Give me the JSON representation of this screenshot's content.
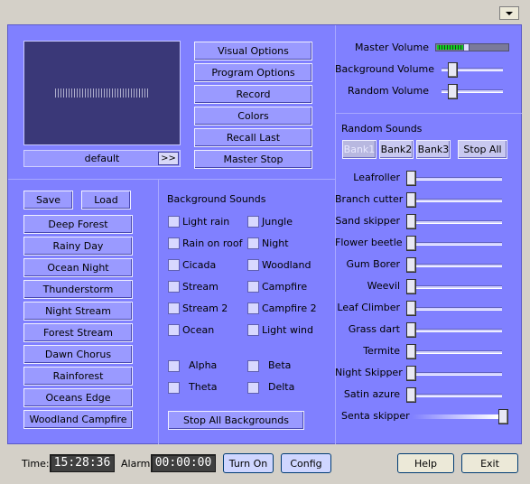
{
  "window": {
    "menu_icon": "chevron-down-icon"
  },
  "preview": {
    "preset_name": "default",
    "next_label": ">>"
  },
  "top_buttons": [
    "Visual Options",
    "Program Options",
    "Record",
    "Colors",
    "Recall Last",
    "Master Stop"
  ],
  "presets": {
    "save_label": "Save",
    "load_label": "Load",
    "items": [
      "Deep Forest",
      "Rainy Day",
      "Ocean Night",
      "Thunderstorm",
      "Night Stream",
      "Forest Stream",
      "Dawn Chorus",
      "Rainforest",
      "Oceans Edge",
      "Woodland Campfire"
    ]
  },
  "background_sounds": {
    "title": "Background Sounds",
    "col1": [
      "Light rain",
      "Rain on roof",
      "Cicada",
      "Stream",
      "Stream 2",
      "Ocean"
    ],
    "col2": [
      "Jungle",
      "Night",
      "Woodland",
      "Campfire",
      "Campfire 2",
      "Light wind"
    ],
    "waves": [
      "Alpha",
      "Beta",
      "Theta",
      "Delta"
    ],
    "stop_all_label": "Stop All Backgrounds"
  },
  "volumes": {
    "master_label": "Master Volume",
    "master_level": 0.4,
    "background_label": "Background Volume",
    "background_level": 0.15,
    "random_label": "Random Volume",
    "random_level": 0.15
  },
  "random_sounds": {
    "title": "Random Sounds",
    "banks": [
      "Bank1",
      "Bank2",
      "Bank3"
    ],
    "active_bank": "Bank1",
    "stop_all_label": "Stop All",
    "items": [
      "Leafroller",
      "Branch cutter",
      "Sand skipper",
      "Flower beetle",
      "Gum Borer",
      "Weevil",
      "Leaf Climber",
      "Grass dart",
      "Termite",
      "Night Skipper",
      "Satin azure",
      "Senta skipper"
    ]
  },
  "status": {
    "time_label": "Time:",
    "time_value": "15:28:36",
    "alarm_label": "Alarm:",
    "alarm_value": "00:00:00",
    "turn_on_label": "Turn On",
    "config_label": "Config",
    "help_label": "Help",
    "exit_label": "Exit"
  },
  "colors": {
    "panel": "#8080ff",
    "button": "#9a9aff",
    "lcd": "#404040"
  }
}
